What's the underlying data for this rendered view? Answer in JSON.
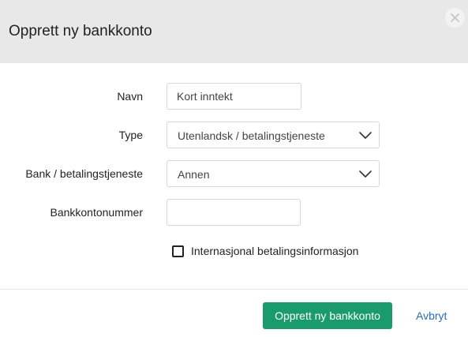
{
  "dialog": {
    "title": "Opprett ny bankkonto",
    "close_icon": "close-icon"
  },
  "form": {
    "name": {
      "label": "Navn",
      "value": "Kort inntekt"
    },
    "type": {
      "label": "Type",
      "selected": "Utenlandsk / betalingstjeneste"
    },
    "bank": {
      "label": "Bank / betalingstjeneste",
      "selected": "Annen"
    },
    "account_number": {
      "label": "Bankkontonummer",
      "value": ""
    },
    "international": {
      "label": "Internasjonal betalingsinformasjon",
      "checked": false
    }
  },
  "actions": {
    "submit_label": "Opprett ny bankkonto",
    "cancel_label": "Avbryt"
  },
  "colors": {
    "header_bg": "#e8e8e8",
    "primary": "#1a9b6c",
    "link": "#2a6fb5"
  }
}
